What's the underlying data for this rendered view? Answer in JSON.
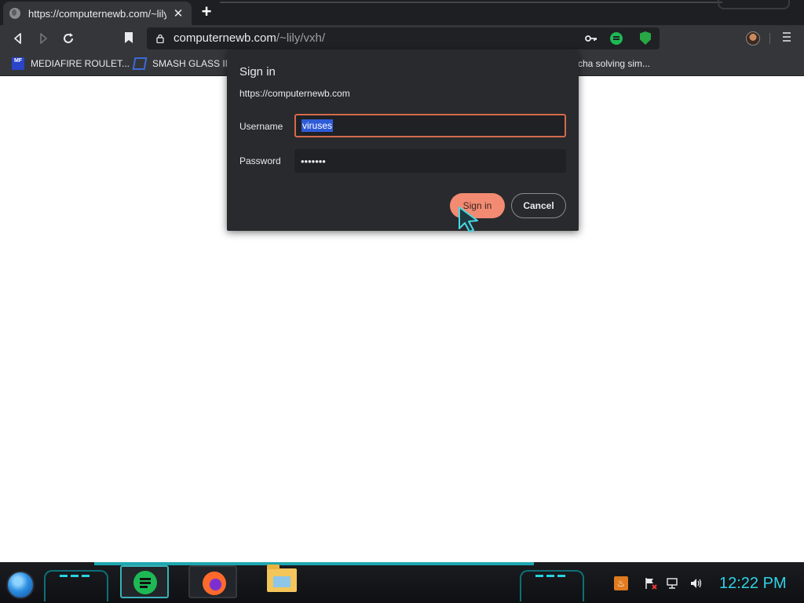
{
  "browser": {
    "tab": {
      "title": "https://computernewb.com/~lily/v",
      "close_glyph": "✕"
    },
    "new_tab_glyph": "+",
    "toolbar": {
      "back_icon": "back-icon",
      "forward_icon": "forward-icon",
      "reload_icon": "reload-icon",
      "url_host": "computernewb.com",
      "url_path": "/~lily/vxh/"
    },
    "bookmarks": [
      {
        "label": "MEDIAFIRE ROULET...",
        "icon": "mediafire-icon",
        "icon_text": "MF"
      },
      {
        "label": "SMASH GLASS IN",
        "icon": "smash-glass-icon"
      },
      {
        "label": "cha solving sim...",
        "icon": "none"
      }
    ]
  },
  "dialog": {
    "title": "Sign in",
    "origin": "https://computernewb.com",
    "username_label": "Username",
    "username_value": "viruses",
    "password_label": "Password",
    "password_value": "•••••••",
    "signin_label": "Sign in",
    "cancel_label": "Cancel"
  },
  "taskbar": {
    "pinned": [
      "spotify",
      "firefox",
      "file-explorer"
    ],
    "clock": "12:22 PM"
  },
  "colors": {
    "chrome_dark": "#35363a",
    "dialog_bg": "#292a2d",
    "accent_signin": "#f28b72",
    "focus_border": "#d46a4c",
    "selection": "#2f5bd8",
    "clock_cyan": "#2fd3e6"
  }
}
